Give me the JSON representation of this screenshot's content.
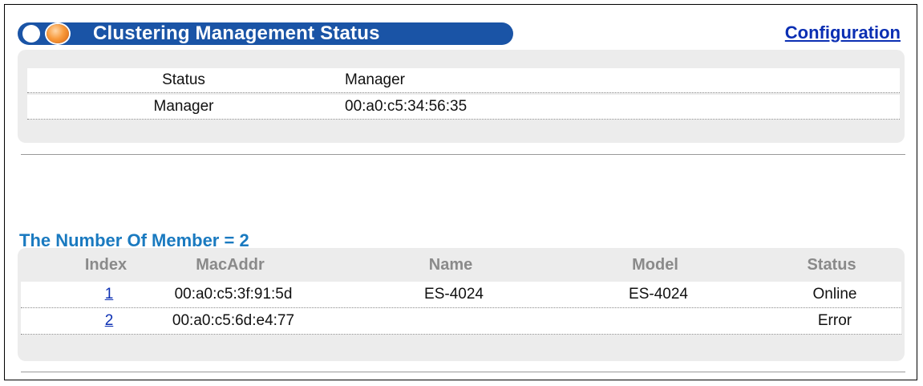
{
  "header": {
    "title": "Clustering Management Status",
    "config_link": "Configuration"
  },
  "status_table": {
    "rows": [
      {
        "label": "Status",
        "value": "Manager"
      },
      {
        "label": "Manager",
        "value": "00:a0:c5:34:56:35"
      }
    ]
  },
  "members": {
    "heading": "The Number Of Member = 2",
    "columns": [
      "Index",
      "MacAddr",
      "Name",
      "Model",
      "Status"
    ],
    "rows": [
      {
        "index": "1",
        "mac": "00:a0:c5:3f:91:5d",
        "name": "ES-4024",
        "model": "ES-4024",
        "status": "Online"
      },
      {
        "index": "2",
        "mac": "00:a0:c5:6d:e4:77",
        "name": "",
        "model": "",
        "status": "Error"
      }
    ]
  },
  "colors": {
    "title_bar": "#1a54a6",
    "link": "#0b2fb3",
    "heading": "#1a7ac0",
    "panel": "#ececec",
    "column_header": "#8a8a8a"
  }
}
